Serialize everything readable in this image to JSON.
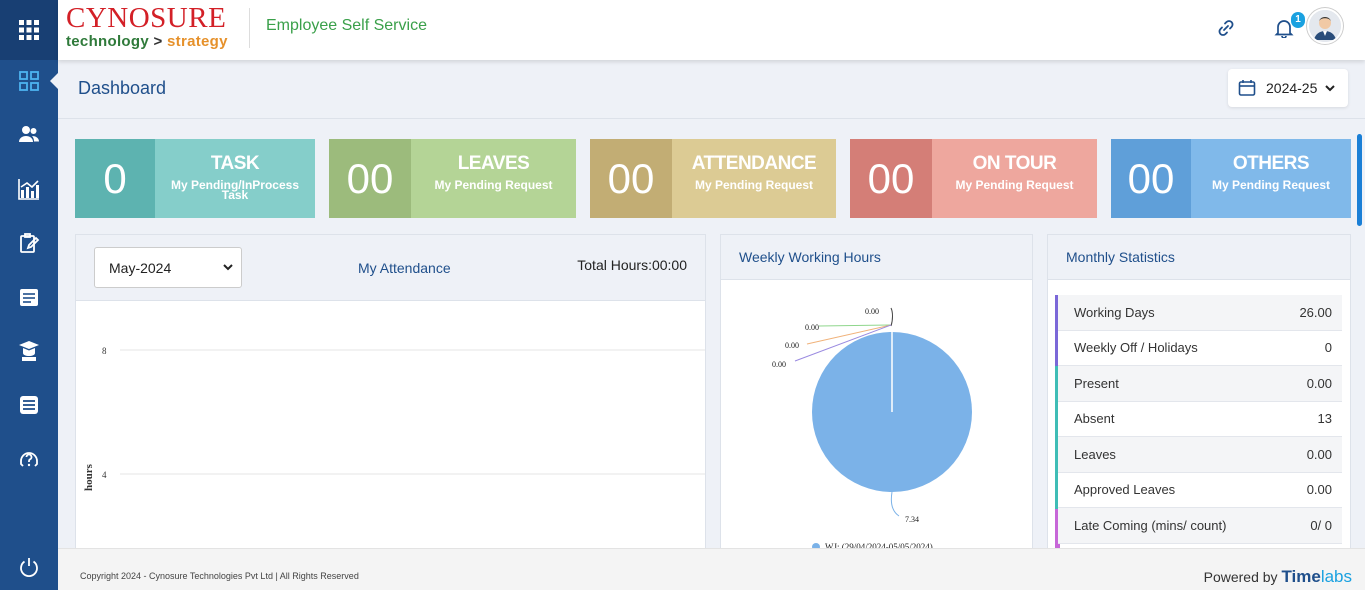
{
  "header": {
    "logo_line1": "CYNOSURE",
    "logo_tech": "technology",
    "logo_gt": ">",
    "logo_strategy": "strategy",
    "app_title": "Employee Self Service",
    "notification_count": "1"
  },
  "sidebar": {
    "items": [
      {
        "icon": "dashboard-icon"
      },
      {
        "icon": "people-icon"
      },
      {
        "icon": "analytics-icon"
      },
      {
        "icon": "clipboard-edit-icon"
      },
      {
        "icon": "id-card-icon"
      },
      {
        "icon": "graduation-icon"
      },
      {
        "icon": "list-document-icon"
      },
      {
        "icon": "help-icon"
      }
    ],
    "power_icon": "power-icon"
  },
  "page": {
    "title": "Dashboard",
    "year": "2024-25"
  },
  "cards": [
    {
      "num": "0",
      "title": "TASK",
      "sub1": "My Pending/InProcess",
      "sub2": "Task",
      "num_color": "#5db3b0",
      "body_color": "#85ceca"
    },
    {
      "num": "00",
      "title": "LEAVES",
      "sub1": "My Pending Request",
      "sub2": "",
      "num_color": "#9cbb7c",
      "body_color": "#b4d496"
    },
    {
      "num": "00",
      "title": "ATTENDANCE",
      "sub1": "My Pending Request",
      "sub2": "",
      "num_color": "#c2ad74",
      "body_color": "#dccb94"
    },
    {
      "num": "00",
      "title": "ON TOUR",
      "sub1": "My Pending Request",
      "sub2": "",
      "num_color": "#d47e77",
      "body_color": "#eea79e"
    },
    {
      "num": "00",
      "title": "OTHERS",
      "sub1": "My Pending Request",
      "sub2": "",
      "num_color": "#5f9fd9",
      "body_color": "#80b9ea"
    }
  ],
  "attendance": {
    "month": "May-2024",
    "title": "My Attendance",
    "total_hours": "Total Hours:00:00"
  },
  "weekly": {
    "title": "Weekly Working Hours",
    "legend": "WJ: (29/04/2024-05/05/2024)"
  },
  "monthly": {
    "title": "Monthly Statistics",
    "rows": [
      {
        "label": "Working Days",
        "value": "26.00"
      },
      {
        "label": "Weekly Off / Holidays",
        "value": "0"
      },
      {
        "label": "Present",
        "value": "0.00"
      },
      {
        "label": "Absent",
        "value": "13"
      },
      {
        "label": "Leaves",
        "value": "0.00"
      },
      {
        "label": "Approved Leaves",
        "value": "0.00"
      },
      {
        "label": "Late Coming (mins/ count)",
        "value": "0/ 0"
      }
    ]
  },
  "chart_data": [
    {
      "type": "line",
      "ylabel": "hours",
      "y_ticks": [
        "8",
        "4"
      ],
      "series": []
    },
    {
      "type": "pie",
      "slices": [
        {
          "label": "0.00",
          "value": 0.0
        },
        {
          "label": "0.00",
          "value": 0.0
        },
        {
          "label": "0.00",
          "value": 0.0
        },
        {
          "label": "0.00",
          "value": 0.0
        },
        {
          "label": "7.34",
          "value": 7.34
        }
      ],
      "colors": [
        "#8c8c8c",
        "#8fd68c",
        "#f0b27a",
        "#9a8ae0",
        "#7bb2e8"
      ],
      "legend": [
        "WJ: (29/04/2024-05/05/2024)"
      ]
    }
  ],
  "footer": {
    "copyright": "Copyright 2024 - Cynosure Technologies Pvt Ltd | All Rights Reserved",
    "powered_by": "Powered by",
    "brand1": "Time",
    "brand2": "labs"
  }
}
